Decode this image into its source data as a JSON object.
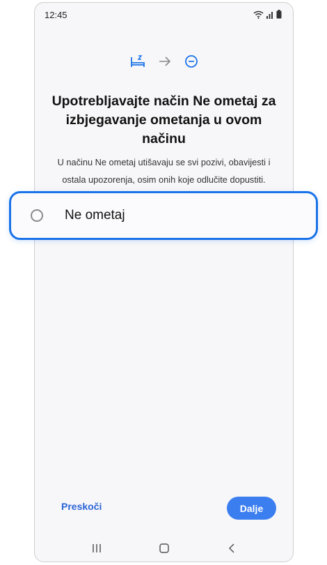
{
  "status_bar": {
    "time": "12:45"
  },
  "flow_icons": [
    "bed-icon",
    "arrow-right-icon",
    "do-not-disturb-icon"
  ],
  "title": "Upotrebljavajte način Ne ometaj za izbjegavanje ometanja u ovom načinu",
  "description": "U načinu Ne ometaj utišavaju se svi pozivi, obavijesti i ostala upozorenja, osim onih koje odlučite dopustiti.",
  "option": {
    "label": "Ne ometaj",
    "selected": false
  },
  "buttons": {
    "skip": "Preskoči",
    "next": "Dalje"
  },
  "colors": {
    "accent": "#1a73e8",
    "button": "#3b7ef0",
    "link": "#2b64d8"
  }
}
